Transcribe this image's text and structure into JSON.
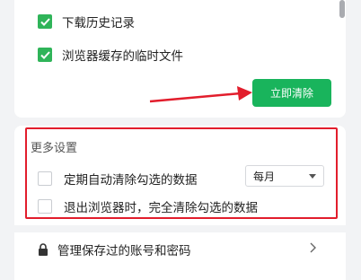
{
  "clear_section": {
    "items": [
      {
        "label": "下载历史记录",
        "checked": true
      },
      {
        "label": "浏览器缓存的临时文件",
        "checked": true
      }
    ],
    "clear_button": "立即清除"
  },
  "more_settings": {
    "title": "更多设置",
    "periodic": {
      "label": "定期自动清除勾选的数据",
      "checked": false,
      "frequency": "每月"
    },
    "on_exit": {
      "label": "退出浏览器时，完全清除勾选的数据",
      "checked": false
    }
  },
  "passwords": {
    "label": "管理保存过的账号和密码"
  },
  "colors": {
    "accent": "#19b45c",
    "highlight": "#e21d2c"
  }
}
